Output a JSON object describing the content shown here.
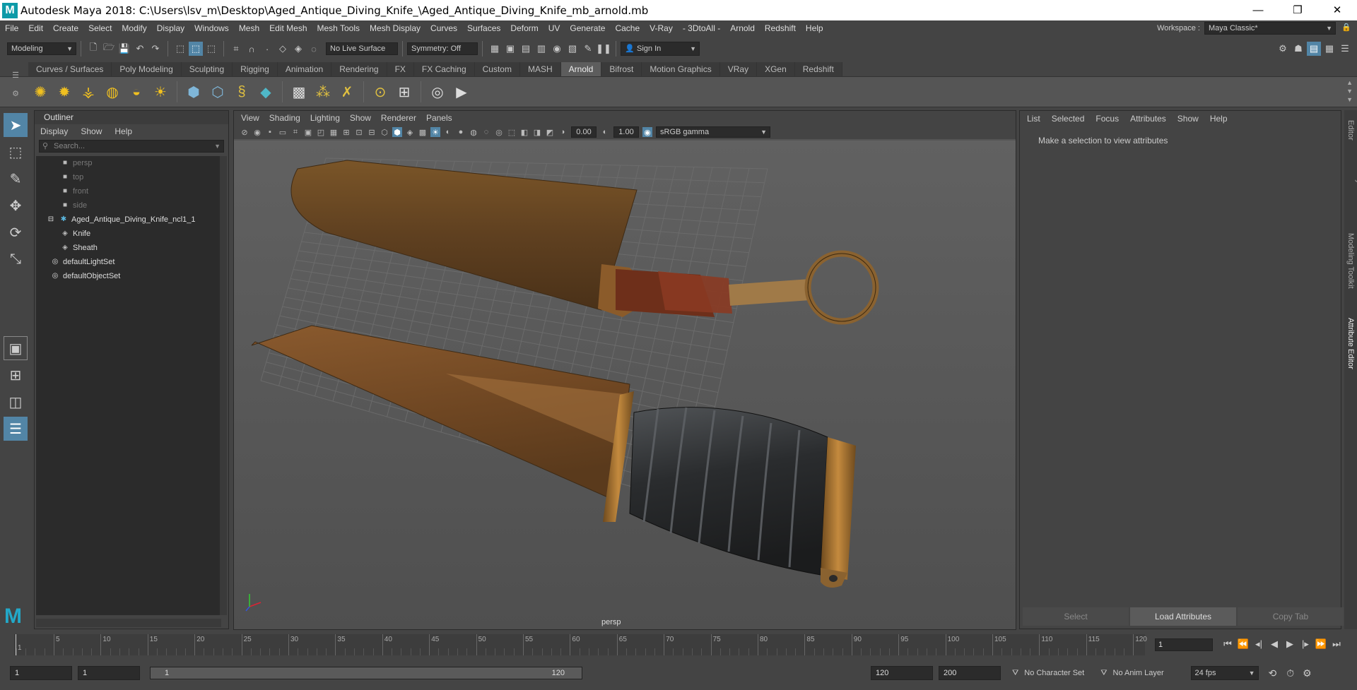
{
  "window": {
    "title": "Autodesk Maya 2018: C:\\Users\\lsv_m\\Desktop\\Aged_Antique_Diving_Knife_\\Aged_Antique_Diving_Knife_mb_arnold.mb",
    "logo": "M",
    "controls": [
      "—",
      "❐",
      "✕"
    ]
  },
  "menubar": {
    "items": [
      "File",
      "Edit",
      "Create",
      "Select",
      "Modify",
      "Display",
      "Windows",
      "Mesh",
      "Edit Mesh",
      "Mesh Tools",
      "Mesh Display",
      "Curves",
      "Surfaces",
      "Deform",
      "UV",
      "Generate",
      "Cache",
      "V-Ray",
      "- 3DtoAll -",
      "Arnold",
      "Redshift",
      "Help"
    ],
    "workspace_label": "Workspace :",
    "workspace_value": "Maya Classic*"
  },
  "statusline": {
    "mode": "Modeling",
    "live_surface": "No Live Surface",
    "symmetry": "Symmetry: Off",
    "sign_in": "Sign In"
  },
  "shelf": {
    "tabs": [
      "Curves / Surfaces",
      "Poly Modeling",
      "Sculpting",
      "Rigging",
      "Animation",
      "Rendering",
      "FX",
      "FX Caching",
      "Custom",
      "MASH",
      "Arnold",
      "Bifrost",
      "Motion Graphics",
      "VRay",
      "XGen",
      "Redshift"
    ],
    "active_tab": "Arnold"
  },
  "outliner": {
    "title": "Outliner",
    "menu": [
      "Display",
      "Show",
      "Help"
    ],
    "search_placeholder": "Search...",
    "items": [
      {
        "label": "persp",
        "icon": "camera-icon",
        "indent": 2,
        "dim": true
      },
      {
        "label": "top",
        "icon": "camera-icon",
        "indent": 2,
        "dim": true
      },
      {
        "label": "front",
        "icon": "camera-icon",
        "indent": 2,
        "dim": true
      },
      {
        "label": "side",
        "icon": "camera-icon",
        "indent": 2,
        "dim": true
      },
      {
        "label": "Aged_Antique_Diving_Knife_ncl1_1",
        "icon": "group-icon",
        "indent": 1,
        "dim": false
      },
      {
        "label": "Knife",
        "icon": "mesh-icon",
        "indent": 2,
        "dim": false
      },
      {
        "label": "Sheath",
        "icon": "mesh-icon",
        "indent": 2,
        "dim": false
      },
      {
        "label": "defaultLightSet",
        "icon": "set-icon",
        "indent": 1,
        "dim": false
      },
      {
        "label": "defaultObjectSet",
        "icon": "set-icon",
        "indent": 1,
        "dim": false
      }
    ]
  },
  "viewport": {
    "menu": [
      "View",
      "Shading",
      "Lighting",
      "Show",
      "Renderer",
      "Panels"
    ],
    "exposure": "0.00",
    "gamma": "1.00",
    "color_space": "sRGB gamma",
    "camera": "persp"
  },
  "attribute_editor": {
    "menu": [
      "List",
      "Selected",
      "Focus",
      "Attributes",
      "Show",
      "Help"
    ],
    "message": "Make a selection to view attributes",
    "buttons": [
      "Select",
      "Load Attributes",
      "Copy Tab"
    ]
  },
  "side_tabs": [
    "Channel Box / Layer Editor",
    "Modeling Toolkit",
    "Attribute Editor"
  ],
  "timeline": {
    "ticks": [
      "5",
      "10",
      "15",
      "20",
      "25",
      "30",
      "35",
      "40",
      "45",
      "50",
      "55",
      "60",
      "65",
      "70",
      "75",
      "80",
      "85",
      "90",
      "95",
      "100",
      "105",
      "110",
      "115",
      "120"
    ],
    "first_tick": "1",
    "current_frame": "1"
  },
  "range": {
    "start": "1",
    "playback_start": "1",
    "slider_start": "1",
    "slider_end": "120",
    "playback_end": "120",
    "end": "200",
    "character_set": "No Character Set",
    "anim_layer": "No Anim Layer",
    "fps": "24 fps"
  },
  "colors": {
    "accent": "#5285a6",
    "sheath": "#6b4a23",
    "blade": "#8a5a2e",
    "handle": "#2d2f31",
    "brass": "#a8702f"
  }
}
